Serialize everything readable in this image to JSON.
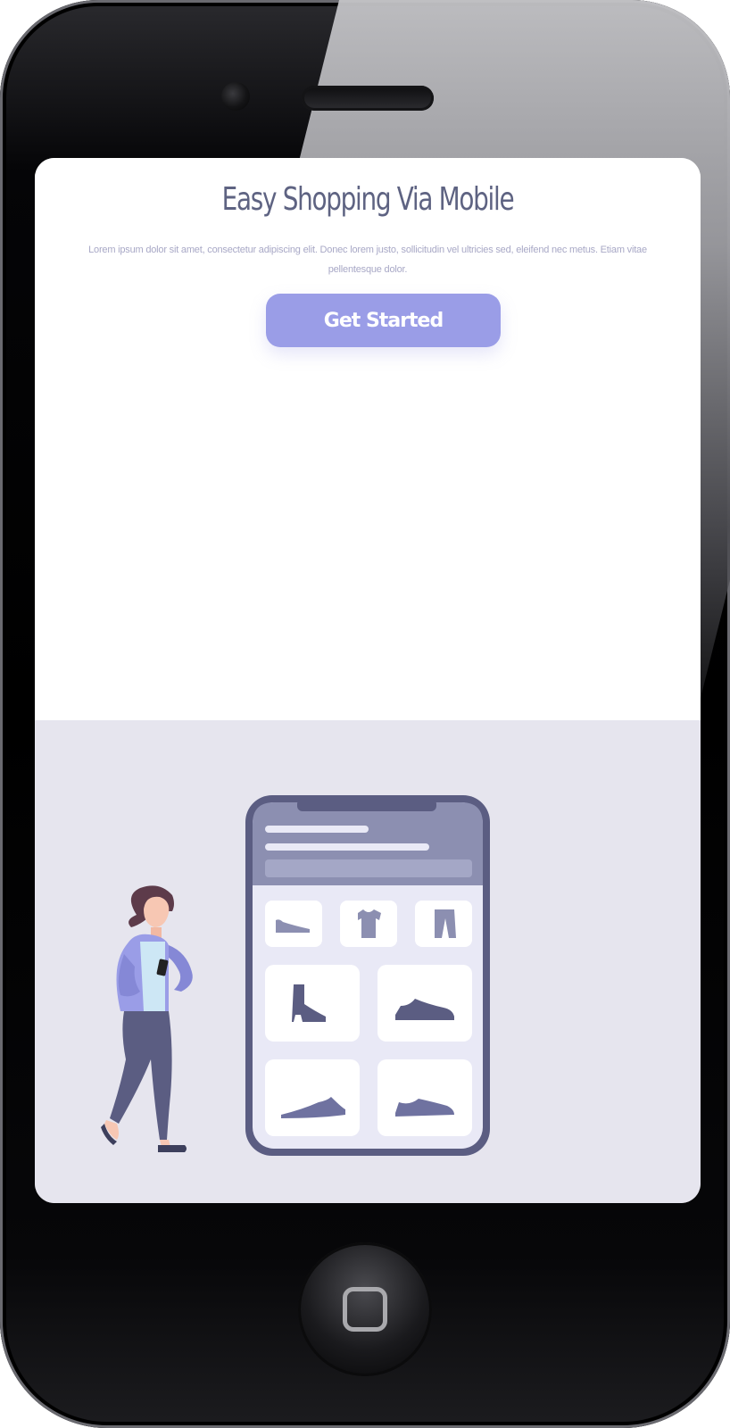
{
  "hero": {
    "title": "Easy Shopping Via Mobile",
    "description": "Lorem ipsum dolor sit amet, consectetur adipiscing elit. Donec lorem justo, sollicitudin vel ultricies sed, eleifend nec metus. Etiam vitae pellentesque dolor.",
    "cta_label": "Get Started"
  },
  "colors": {
    "accent": "#9a9de7",
    "title": "#5e6382",
    "illustration_background": "#e6e5ee",
    "illustration_primary": "#5b5d82"
  },
  "illustration": {
    "product_icons": [
      "flat-shoe-icon",
      "tshirt-icon",
      "pants-icon",
      "boot-icon",
      "sneaker-icon",
      "sneaker-icon",
      "sneaker-icon"
    ]
  }
}
